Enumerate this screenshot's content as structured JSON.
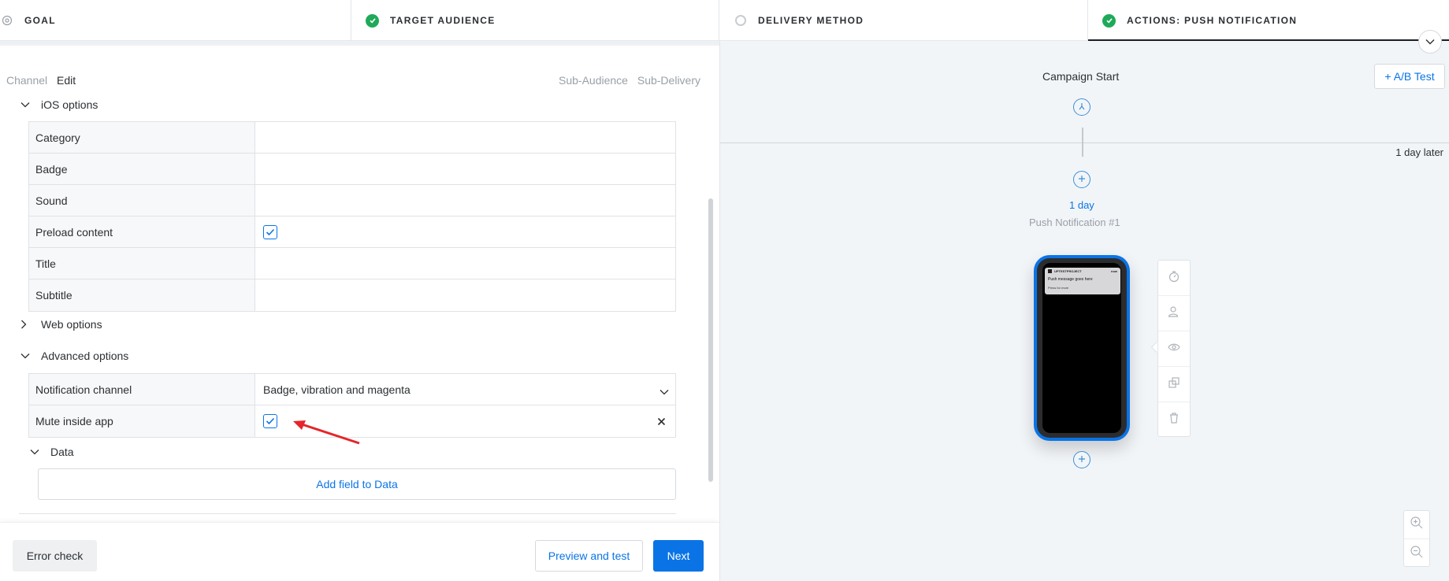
{
  "stepper": {
    "steps": [
      {
        "label": "GOAL",
        "state": "incomplete"
      },
      {
        "label": "TARGET AUDIENCE",
        "state": "complete"
      },
      {
        "label": "DELIVERY METHOD",
        "state": "incomplete"
      },
      {
        "label": "ACTIONS: PUSH NOTIFICATION",
        "state": "complete-active"
      }
    ]
  },
  "editor": {
    "tabs": {
      "channel": "Channel",
      "edit": "Edit"
    },
    "subnav": {
      "sub_audience": "Sub-Audience",
      "sub_delivery": "Sub-Delivery"
    },
    "ios_options": {
      "title": "iOS options",
      "rows": [
        {
          "label": "Category",
          "value": ""
        },
        {
          "label": "Badge",
          "value": ""
        },
        {
          "label": "Sound",
          "value": ""
        },
        {
          "label": "Preload content",
          "checked": true
        },
        {
          "label": "Title",
          "value": ""
        },
        {
          "label": "Subtitle",
          "value": ""
        }
      ]
    },
    "web_options": {
      "title": "Web options"
    },
    "advanced_options": {
      "title": "Advanced options",
      "rows": [
        {
          "label": "Notification channel",
          "value": "Badge, vibration and magenta"
        },
        {
          "label": "Mute inside app",
          "checked": true
        }
      ]
    },
    "data_section": {
      "title": "Data",
      "add_button": "Add field to Data"
    }
  },
  "footer": {
    "error_check": "Error check",
    "preview": "Preview and test",
    "next": "Next"
  },
  "canvas": {
    "ab_test": "+ A/B Test",
    "campaign_start": "Campaign Start",
    "delay_label": "1 day later",
    "node_delay": "1 day",
    "node_title": "Push Notification #1",
    "phone_preview": {
      "app_name": "UPTESTPROJECT",
      "time": "now",
      "message": "Push message goes here",
      "sub": "Press for more"
    }
  },
  "colors": {
    "accent": "#0a74e6",
    "complete": "#1faa59",
    "annotation": "#e5252a"
  }
}
